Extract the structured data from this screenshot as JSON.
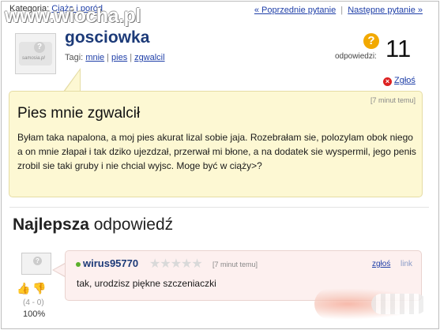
{
  "category": {
    "label": "Kategoria:",
    "path": [
      "Ciąża i poród"
    ]
  },
  "watermark": "www.wiocha.pl",
  "nav": {
    "prev_label": "« Poprzednie pytanie",
    "separator": "|",
    "next_label": "Następne pytanie »"
  },
  "question": {
    "author": "gosciowka",
    "avatar_text": "samosia.pl",
    "tags_label": "Tagi:",
    "tags": [
      "mnie",
      "pies",
      "zgwalcil"
    ],
    "answers_label": "odpowiedzi:",
    "answers_count": "11",
    "report_label": "Zgłoś",
    "time": "[7 minut temu]",
    "title": "Pies mnie zgwalcił",
    "body": "Byłam taka napalona, a moj pies akurat lizal sobie jaja. Rozebrałam sie, polozylam obok niego a on mnie złapał i tak dziko ujezdzał, przerwał mi błone, a na dodatek sie wyspermil, jego penis zrobil sie taki gruby i nie chcial wyjsc. Moge być w ciąży>?"
  },
  "best_answer": {
    "heading_bold": "Najlepsza",
    "heading_rest": "odpowiedź",
    "author": "wirus95770",
    "rating_stars": 0,
    "time": "[7 minut temu]",
    "report_label": "zgłoś",
    "link_label": "link",
    "body": "tak, urodzisz piękne szczeniaczki",
    "votes": "(4 - 0)",
    "percent": "100%"
  },
  "colors": {
    "link": "#1f3fa8",
    "username": "#1c3a78",
    "question_bg": "#fdf8d3",
    "answer_bg": "#fdf0ef",
    "answer_icon": "#f2a900",
    "online_dot": "#5bb02c",
    "report_icon": "#d22222"
  },
  "icons": {
    "answers": "question-mark-icon",
    "report": "close-icon",
    "vote_up": "thumb-up-icon",
    "vote_down": "thumb-down-icon",
    "status": "online-dot-icon",
    "rating": "star-icon"
  }
}
